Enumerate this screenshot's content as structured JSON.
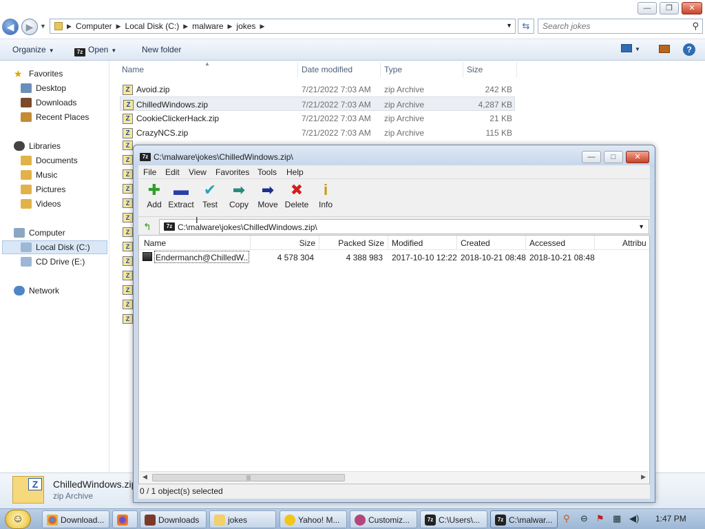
{
  "explorer": {
    "breadcrumb": [
      "Computer",
      "Local Disk (C:)",
      "malware",
      "jokes"
    ],
    "search_placeholder": "Search jokes",
    "commands": {
      "organize": "Organize",
      "open": "Open",
      "new_folder": "New folder"
    },
    "nav": {
      "favorites": "Favorites",
      "desktop": "Desktop",
      "downloads": "Downloads",
      "recent_places": "Recent Places",
      "libraries": "Libraries",
      "documents": "Documents",
      "music": "Music",
      "pictures": "Pictures",
      "videos": "Videos",
      "computer": "Computer",
      "local_disk": "Local Disk (C:)",
      "cd_drive": "CD Drive (E:)",
      "network": "Network"
    },
    "columns": {
      "name": "Name",
      "date": "Date modified",
      "type": "Type",
      "size": "Size"
    },
    "files": [
      {
        "name": "Avoid.zip",
        "date": "7/21/2022 7:03 AM",
        "type": "zip Archive",
        "size": "242 KB"
      },
      {
        "name": "ChilledWindows.zip",
        "date": "7/21/2022 7:03 AM",
        "type": "zip Archive",
        "size": "4,287 KB"
      },
      {
        "name": "CookieClickerHack.zip",
        "date": "7/21/2022 7:03 AM",
        "type": "zip Archive",
        "size": "21 KB"
      },
      {
        "name": "CrazyNCS.zip",
        "date": "7/21/2022 7:03 AM",
        "type": "zip Archive",
        "size": "115 KB"
      }
    ],
    "details": {
      "name": "ChilledWindows.zip",
      "type": "zip Archive"
    }
  },
  "sevenzip": {
    "title": "C:\\malware\\jokes\\ChilledWindows.zip\\",
    "menu": [
      "File",
      "Edit",
      "View",
      "Favorites",
      "Tools",
      "Help"
    ],
    "toolbar": {
      "add": "Add",
      "extract": "Extract",
      "test": "Test",
      "copy": "Copy",
      "move": "Move",
      "delete": "Delete",
      "info": "Info"
    },
    "path": "C:\\malware\\jokes\\ChilledWindows.zip\\",
    "columns": {
      "name": "Name",
      "size": "Size",
      "packed": "Packed Size",
      "modified": "Modified",
      "created": "Created",
      "accessed": "Accessed",
      "attributes": "Attribu"
    },
    "rows": [
      {
        "name": "Endermanch@ChilledW...",
        "size": "4 578 304",
        "packed": "4 388 983",
        "modified": "2017-10-10 12:22",
        "created": "2018-10-21 08:48",
        "accessed": "2018-10-21 08:48"
      }
    ],
    "status": "0 / 1 object(s) selected"
  },
  "taskbar": {
    "items": [
      "Download...",
      "Downloads",
      "jokes",
      "Yahoo! M...",
      "Customiz...",
      "C:\\Users\\...",
      "C:\\malwar..."
    ],
    "clock": "1:47 PM"
  },
  "colors": {
    "accent": "#3a6fb3",
    "titlebar": "#c4d5ea",
    "selection": "#d9e7f7"
  }
}
